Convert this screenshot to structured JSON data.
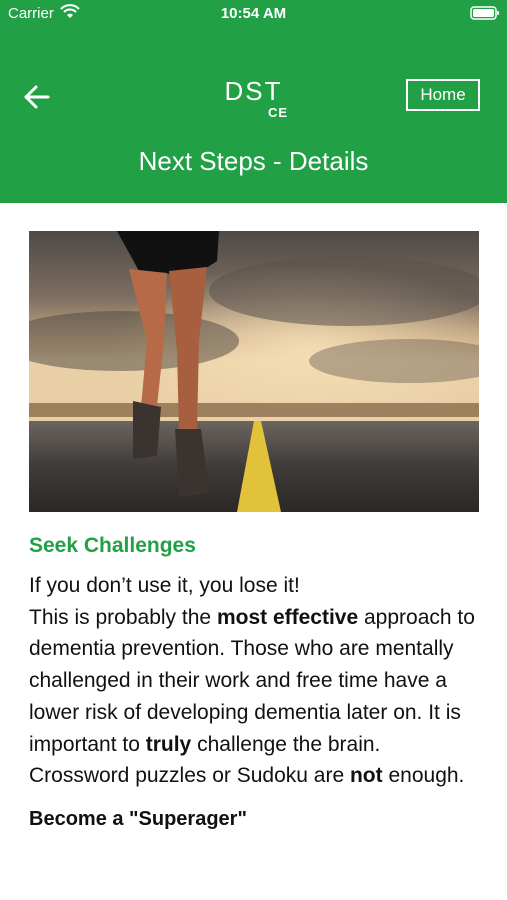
{
  "status_bar": {
    "carrier": "Carrier",
    "time": "10:54 AM",
    "wifi_icon": "wifi-icon",
    "battery_icon": "battery-icon"
  },
  "nav": {
    "app_title": "DST",
    "ce_mark": "CE",
    "home_label": "Home",
    "back_icon": "arrow-left-icon",
    "page_title": "Next Steps - Details"
  },
  "hero_image": {
    "description_icon": "runner-on-road-image"
  },
  "content": {
    "section_title": "Seek Challenges",
    "line1": "If you don’t use it, you lose it!",
    "p1": "This is probably the ",
    "p1_bold": "most effective",
    "p2": " approach to dementia prevention. Those who are mentally challenged in their work and free time have a lower risk of developing dementia later on. It is important to ",
    "p2_bold": "truly",
    "p3": " challenge the brain. Crossword puzzles or Sudoku are ",
    "p3_bold": "not",
    "p4": " enough.",
    "next_section_title": "Become a \"Superager\""
  },
  "colors": {
    "brand_green": "#22a046",
    "text": "#111111",
    "background": "#ffffff"
  }
}
